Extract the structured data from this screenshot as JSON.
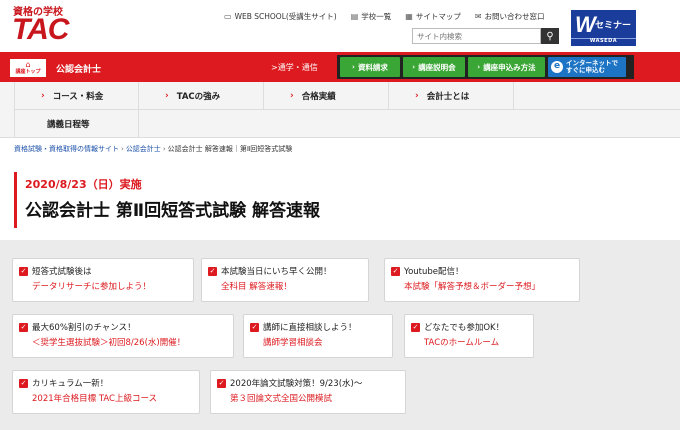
{
  "header": {
    "logo_sub": "資格の学校",
    "logo_main": "TAC",
    "links": [
      {
        "icon": "monitor-icon",
        "label": "WEB SCHOOL(受講生サイト)"
      },
      {
        "icon": "list-icon",
        "label": "学校一覧"
      },
      {
        "icon": "sitemap-icon",
        "label": "サイトマップ"
      },
      {
        "icon": "mail-icon",
        "label": "お問い合わせ窓口"
      }
    ],
    "search_placeholder": "サイト内検索",
    "search_icon": "search-icon",
    "partner_logo": {
      "mark": "W",
      "text": "セミナー",
      "sub": "WASEDA"
    }
  },
  "navbar": {
    "home_label": "講座トップ",
    "section_title": "公認会計士",
    "kayoi_label": ">通学・通信",
    "buttons": [
      {
        "label": "資料請求"
      },
      {
        "label": "講座説明会"
      },
      {
        "label": "講座申込み方法"
      }
    ],
    "internet_button": {
      "line1": "インターネットで",
      "line2": "すぐに申込む"
    },
    "colors": {
      "red": "#dc1a1f",
      "green": "#3aa635",
      "blue": "#1d74c4"
    }
  },
  "menu": {
    "row1": [
      "コース・料金",
      "TACの強み",
      "合格実績",
      "会計士とは"
    ],
    "row2": [
      "講義日程等"
    ]
  },
  "breadcrumb": {
    "items": [
      "資格試験・資格取得の情報サイト",
      "公認会計士",
      "公認会計士 解答速報｜第Ⅱ回短答式試験"
    ]
  },
  "page": {
    "date": "2020/8/23（日）実施",
    "title": "公認会計士 第Ⅱ回短答式試験 解答速報"
  },
  "cards": [
    {
      "line1": "短答式試験後は",
      "line2": "データリサーチに参加しよう！"
    },
    {
      "line1": "本試験当日にいち早く公開！",
      "line2": "全科目 解答速報！"
    },
    {
      "line1": "Youtube配信！",
      "line2": "本試験「解答予想＆ボーダー予想」"
    },
    {
      "line1": "最大60%割引のチャンス！",
      "line2": "＜奨学生選抜試験＞初回8/26(水)開催！"
    },
    {
      "line1": "講師に直接相談しよう！",
      "line2": "講師学習相談会"
    },
    {
      "line1": "どなたでも参加OK！",
      "line2": "TACのホームルーム"
    },
    {
      "line1": "カリキュラム一新！",
      "line2": "2021年合格目標 TAC上級コース"
    },
    {
      "line1": "2020年論文試験対策！9/23(水)～",
      "line2": "第３回論文式全国公開模試"
    }
  ]
}
